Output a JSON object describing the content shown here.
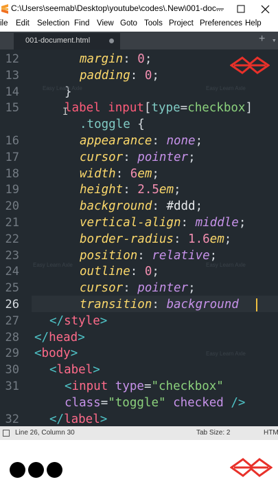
{
  "window": {
    "title": "C:\\Users\\seemab\\Desktop\\youtube\\codes\\.New\\001-doc..."
  },
  "menu": [
    "ile",
    "Edit",
    "Selection",
    "Find",
    "View",
    "Goto",
    "Tools",
    "Project",
    "Preferences",
    "Help"
  ],
  "tab": {
    "label": "001-document.html"
  },
  "tabbar": {
    "plus": "+",
    "dropdown": "▾"
  },
  "editor": {
    "line_numbers": [
      "12",
      "13",
      "14",
      "15",
      "",
      "16",
      "17",
      "18",
      "19",
      "20",
      "21",
      "22",
      "23",
      "24",
      "25",
      "26",
      "27",
      "28",
      "29",
      "30",
      "31",
      "",
      "32"
    ],
    "current_line": "26",
    "watermark": "Easy Learn Axle",
    "lines": [
      [
        [
          "t-prop",
          "margin"
        ],
        [
          "t-punc",
          ": "
        ],
        [
          "t-num",
          "0"
        ],
        [
          "t-punc",
          ";"
        ]
      ],
      [
        [
          "t-prop",
          "padding"
        ],
        [
          "t-punc",
          ": "
        ],
        [
          "t-num",
          "0"
        ],
        [
          "t-punc",
          ";"
        ]
      ],
      [
        [
          "t-punc",
          "}"
        ]
      ],
      [
        [
          "t-tag",
          "label"
        ],
        [
          "t-punc",
          " "
        ],
        [
          "t-tag",
          "input"
        ],
        [
          "t-punc",
          "["
        ],
        [
          "t-sel",
          "type"
        ],
        [
          "t-punc",
          "="
        ],
        [
          "t-str",
          "checkbox"
        ],
        [
          "t-punc",
          "]"
        ]
      ],
      [
        [
          "t-sel",
          ".toggle"
        ],
        [
          "t-punc",
          " {"
        ]
      ],
      [
        [
          "t-prop",
          "appearance"
        ],
        [
          "t-punc",
          ": "
        ],
        [
          "t-kw",
          "none"
        ],
        [
          "t-punc",
          ";"
        ]
      ],
      [
        [
          "t-prop",
          "cursor"
        ],
        [
          "t-punc",
          ": "
        ],
        [
          "t-kw",
          "pointer"
        ],
        [
          "t-punc",
          ";"
        ]
      ],
      [
        [
          "t-prop",
          "width"
        ],
        [
          "t-punc",
          ": "
        ],
        [
          "t-num",
          "6"
        ],
        [
          "t-unit",
          "em"
        ],
        [
          "t-punc",
          ";"
        ]
      ],
      [
        [
          "t-prop",
          "height"
        ],
        [
          "t-punc",
          ": "
        ],
        [
          "t-num",
          "2.5"
        ],
        [
          "t-unit",
          "em"
        ],
        [
          "t-punc",
          ";"
        ]
      ],
      [
        [
          "t-prop",
          "background"
        ],
        [
          "t-punc",
          ": "
        ],
        [
          "t-txt",
          "#ddd"
        ],
        [
          "t-punc",
          ";"
        ]
      ],
      [
        [
          "t-prop",
          "vertical-align"
        ],
        [
          "t-punc",
          ": "
        ],
        [
          "t-kw",
          "middle"
        ],
        [
          "t-punc",
          ";"
        ]
      ],
      [
        [
          "t-prop",
          "border-radius"
        ],
        [
          "t-punc",
          ": "
        ],
        [
          "t-num",
          "1.6"
        ],
        [
          "t-unit",
          "em"
        ],
        [
          "t-punc",
          ";"
        ]
      ],
      [
        [
          "t-prop",
          "position"
        ],
        [
          "t-punc",
          ": "
        ],
        [
          "t-kw",
          "relative"
        ],
        [
          "t-punc",
          ";"
        ]
      ],
      [
        [
          "t-prop",
          "outline"
        ],
        [
          "t-punc",
          ": "
        ],
        [
          "t-num",
          "0"
        ],
        [
          "t-punc",
          ";"
        ]
      ],
      [
        [
          "t-prop",
          "cursor"
        ],
        [
          "t-punc",
          ": "
        ],
        [
          "t-kw",
          "pointer"
        ],
        [
          "t-punc",
          ";"
        ]
      ],
      [
        [
          "t-prop",
          "transition"
        ],
        [
          "t-punc",
          ": "
        ],
        [
          "t-kw",
          "background"
        ]
      ],
      [
        [
          "t-tg",
          "</"
        ],
        [
          "t-tn",
          "style"
        ],
        [
          "t-tg",
          ">"
        ]
      ],
      [
        [
          "t-tg",
          "</"
        ],
        [
          "t-tn",
          "head"
        ],
        [
          "t-tg",
          ">"
        ]
      ],
      [
        [
          "t-tg",
          "<"
        ],
        [
          "t-tn",
          "body"
        ],
        [
          "t-tg",
          ">"
        ]
      ],
      [
        [
          "t-tg",
          "<"
        ],
        [
          "t-tn",
          "label"
        ],
        [
          "t-tg",
          ">"
        ]
      ],
      [
        [
          "t-tg",
          "<"
        ],
        [
          "t-tn",
          "input"
        ],
        [
          "t-punc",
          " "
        ],
        [
          "t-attr",
          "type"
        ],
        [
          "t-punc",
          "="
        ],
        [
          "t-str",
          "\"checkbox\""
        ]
      ],
      [
        [
          "t-attr",
          "class"
        ],
        [
          "t-punc",
          "="
        ],
        [
          "t-str",
          "\"toggle\""
        ],
        [
          "t-punc",
          " "
        ],
        [
          "t-attr",
          "checked"
        ],
        [
          "t-punc",
          " "
        ],
        [
          "t-tg",
          "/>"
        ]
      ],
      [
        [
          "t-tg",
          "</"
        ],
        [
          "t-tn",
          "label"
        ],
        [
          "t-tg",
          ">"
        ]
      ]
    ]
  },
  "statusbar": {
    "position": "Line 26, Column 30",
    "tab_size": "Tab Size: 2",
    "syntax": "HTM"
  },
  "colors": {
    "editor_bg": "#232a30",
    "logo_red": "#e8312a",
    "caret": "#f0c040"
  }
}
